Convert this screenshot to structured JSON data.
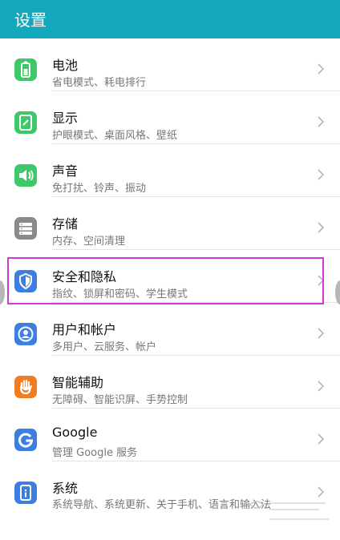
{
  "header": {
    "title": "设置"
  },
  "items": [
    {
      "title": "电池",
      "subtitle": "省电模式、耗电排行",
      "icon": "battery-icon",
      "color": "#3ec86a"
    },
    {
      "title": "显示",
      "subtitle": "护眼模式、桌面风格、壁纸",
      "icon": "display-icon",
      "color": "#3ec86a"
    },
    {
      "title": "声音",
      "subtitle": "免打扰、铃声、振动",
      "icon": "speaker-icon",
      "color": "#3ec86a"
    },
    {
      "title": "存储",
      "subtitle": "内存、空间清理",
      "icon": "storage-icon",
      "color": "#8a8a8a"
    },
    {
      "title": "安全和隐私",
      "subtitle": "指纹、锁屏和密码、学生模式",
      "icon": "shield-icon",
      "color": "#3c7fe0"
    },
    {
      "title": "用户和帐户",
      "subtitle": "多用户、云服务、帐户",
      "icon": "user-icon",
      "color": "#3c7fe0"
    },
    {
      "title": "智能辅助",
      "subtitle": "无障碍、智能识屏、手势控制",
      "icon": "hand-icon",
      "color": "#f07c23"
    },
    {
      "title": "Google",
      "subtitle": "管理 Google 服务",
      "icon": "google-icon",
      "color": "#3c7fe0"
    },
    {
      "title": "系统",
      "subtitle": "系统导航、系统更新、关于手机、语言和输入法",
      "icon": "system-icon",
      "color": "#3c7fe0"
    }
  ]
}
